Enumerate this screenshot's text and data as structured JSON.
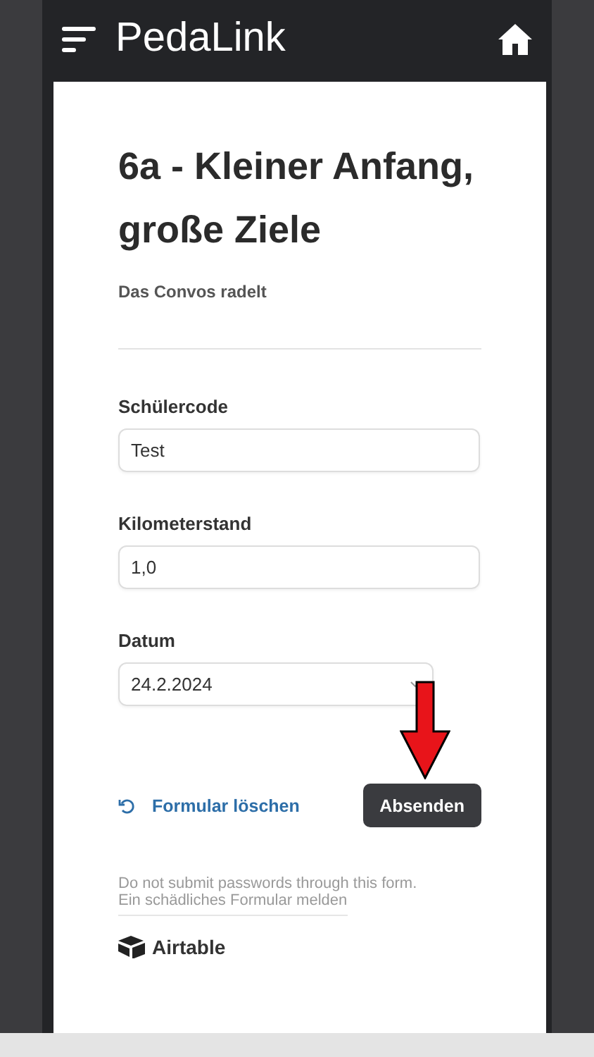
{
  "app_bar": {
    "title": "PedaLink"
  },
  "form": {
    "title": "6a - Kleiner Anfang, große Ziele",
    "subtitle": "Das Convos radelt",
    "fields": [
      {
        "kind": "text",
        "label": "Schülercode",
        "value": "Test"
      },
      {
        "kind": "text",
        "label": "Kilometerstand",
        "value": "1,0"
      },
      {
        "kind": "date",
        "label": "Datum",
        "value": "24.2.2024"
      }
    ],
    "clear_button": "Formular löschen",
    "submit_button": "Absenden",
    "notice": "Do not submit passwords through this form.",
    "report_link": "Ein schädliches Formular melden",
    "brand": "Airtable"
  }
}
